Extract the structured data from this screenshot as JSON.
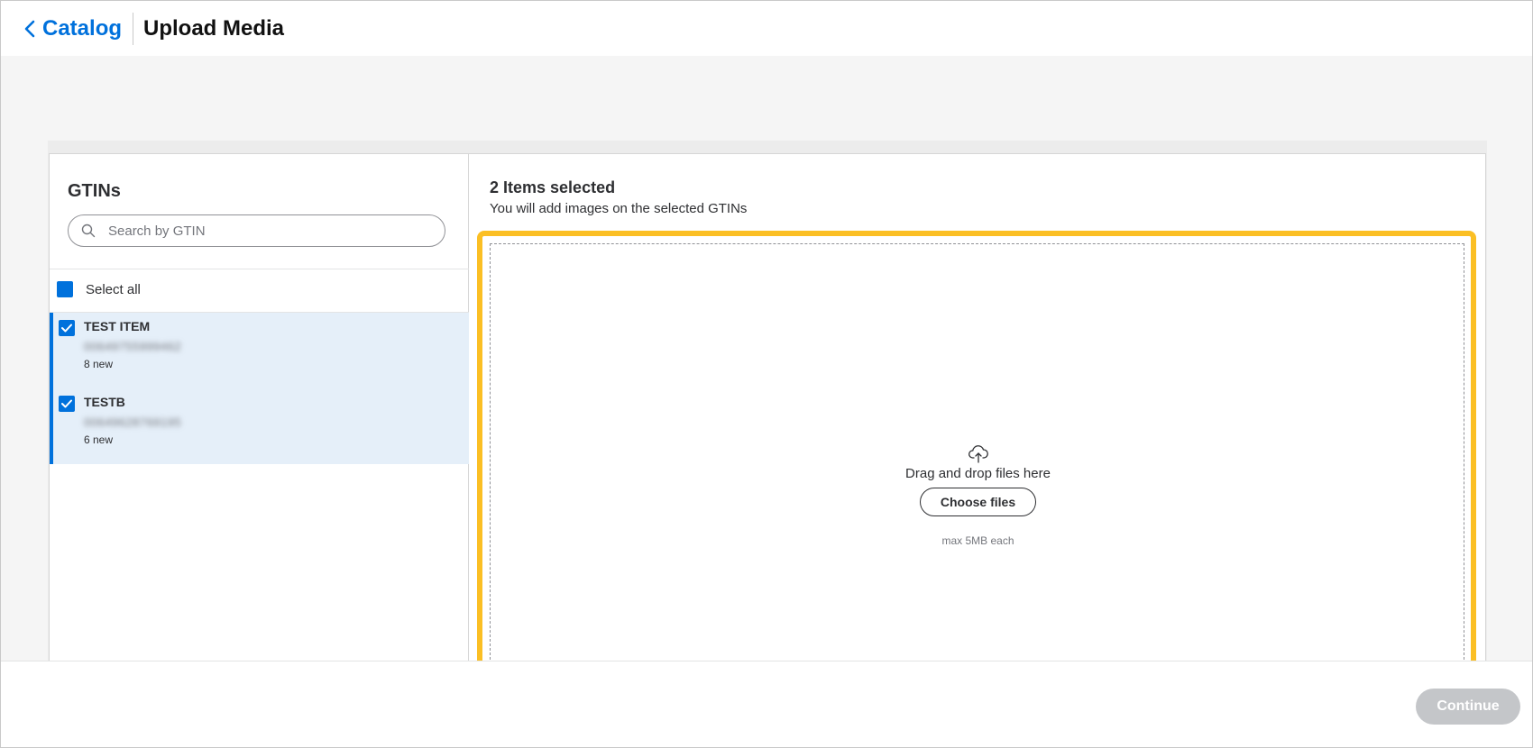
{
  "header": {
    "back_label": "Catalog",
    "title": "Upload Media"
  },
  "left": {
    "title": "GTINs",
    "search_placeholder": "Search by GTIN",
    "select_all_label": "Select all",
    "items": [
      {
        "name": "TEST ITEM",
        "gtin": "00649755999462",
        "count": "8 new",
        "checked": true
      },
      {
        "name": "TESTB",
        "gtin": "00649628769195",
        "count": "6 new",
        "checked": true
      }
    ]
  },
  "right": {
    "selected_title": "2 Items selected",
    "selected_sub": "You will add images on the selected GTINs",
    "dropzone": {
      "drag_text": "Drag and drop files here",
      "choose_label": "Choose files",
      "max_text": "max 5MB each"
    }
  },
  "footer": {
    "continue_label": "Continue"
  },
  "colors": {
    "accent": "#0071dc",
    "highlight": "#fbbf24",
    "selected_bg": "#e5eff9",
    "disabled_button": "#c4c6c9"
  }
}
